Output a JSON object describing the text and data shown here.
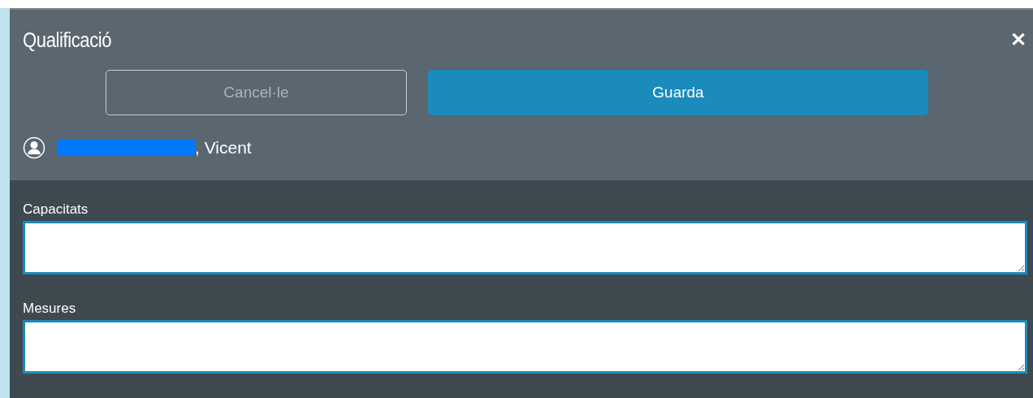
{
  "dialog": {
    "title": "Qualificació",
    "close": "✕",
    "buttons": [
      {
        "label": "Cancel·le",
        "kind": "secondary"
      },
      {
        "label": "Guarda",
        "kind": "primary"
      }
    ],
    "user": {
      "name": ", Vicent"
    },
    "fields": [
      {
        "label": "Capacitats"
      },
      {
        "label": "Mesures"
      }
    ]
  }
}
